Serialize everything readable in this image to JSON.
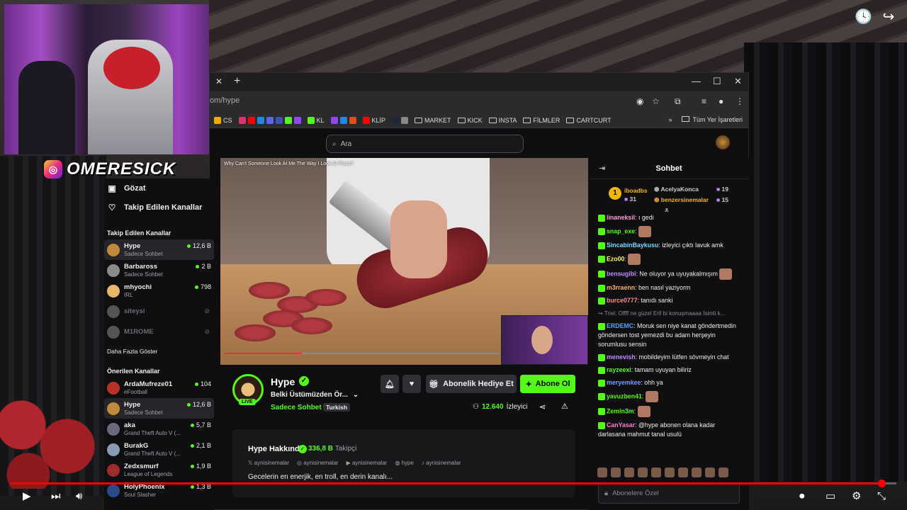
{
  "overlay": {
    "brand": "OMERESICK",
    "instagram_icon": "instagram-icon"
  },
  "browser": {
    "url": "om/hype",
    "bookmarks": [
      "CS",
      "KL",
      "KLİP",
      "MARKET",
      "KICK",
      "INSTA",
      "FİLMLER",
      "CARTCURT"
    ],
    "all_bookmarks": "Tüm Yer İşaretleri",
    "more_bookmarks": "»"
  },
  "kick": {
    "search_placeholder": "Ara",
    "nav": [
      {
        "label": "Gözat",
        "icon": "browse-icon"
      },
      {
        "label": "Takip Edilen Kanallar",
        "icon": "heart-icon"
      }
    ],
    "followed_title": "Takip Edilen Kanallar",
    "followed": [
      {
        "name": "Hype",
        "sub": "Sadece Sohbet",
        "count": "12,6 B",
        "color": "#c08a3c"
      },
      {
        "name": "Barbaross",
        "sub": "Sadece Sohbet",
        "count": "2 B",
        "color": "#8a8a8a"
      },
      {
        "name": "mhyochi",
        "sub": "IRL",
        "count": "798",
        "color": "#e6b86a"
      },
      {
        "name": "siteysi",
        "sub": "",
        "count": "",
        "color": "#555"
      },
      {
        "name": "M1ROME",
        "sub": "",
        "count": "",
        "color": "#555"
      }
    ],
    "show_more": "Daha Fazla Göster",
    "recommended_title": "Önerilen Kanallar",
    "recommended": [
      {
        "name": "ArdaMufreze01",
        "sub": "eFootball",
        "count": "104",
        "color": "#b8322a"
      },
      {
        "name": "Hype",
        "sub": "Sadece Sohbet",
        "count": "12,6 B",
        "color": "#c08a3c"
      },
      {
        "name": "aka",
        "sub": "Grand Theft Auto V (...",
        "count": "5,7 B",
        "color": "#6a6a7a"
      },
      {
        "name": "BurakG",
        "sub": "Grand Theft Auto V (...",
        "count": "2,1 B",
        "color": "#8a9ab0"
      },
      {
        "name": "Zedxsmurf",
        "sub": "League of Legends",
        "count": "1,9 B",
        "color": "#a02a2a"
      },
      {
        "name": "HolyPhoenix",
        "sub": "Soul Slasher",
        "count": "1,3 B",
        "color": "#2a4a8a"
      }
    ],
    "video_title": "Why Can't Someone Look At Me The Way I Look At Pizza?",
    "channel": {
      "name": "Hype",
      "live": "LIVE",
      "stream_title": "Belki Üstümüzden Ör...",
      "category": "Sadece Sohbet",
      "tag": "Turkish",
      "gift_label": "Abonelik Hediye Et",
      "sub_label": "Abone Ol",
      "viewers": "12.640",
      "viewers_label": "İzleyici"
    },
    "about": {
      "title": "Hype Hakkında",
      "followers": "336,8 B",
      "followers_label": "Takipçi",
      "socials": [
        "aynisinemalar",
        "aynisinemalar",
        "aynisinemalar",
        "hype",
        "aynisinemalar"
      ],
      "description": "Gecelerin en enerjik, en troll, en derin kanalı..."
    },
    "chat": {
      "title": "Sohbet",
      "gifters": [
        {
          "name": "iboadbs",
          "count": "31",
          "rank": "1"
        },
        {
          "name": "AcelyaKonca",
          "count": "19"
        },
        {
          "name": "benzersinemalar",
          "count": "15"
        }
      ],
      "messages": [
        {
          "user": "linaneksil",
          "text": ": ı gedi",
          "color": "#ff9ad0"
        },
        {
          "user": "snap_exe",
          "text": ":",
          "color": "#53fc18",
          "emote": true
        },
        {
          "user": "SincabinBaykusu",
          "text": ": izleyici çıktı lavuk amk",
          "color": "#7ad6ff"
        },
        {
          "user": "Ezo00",
          "text": ":",
          "color": "#fff36a",
          "emote": true
        },
        {
          "user": "bensugibi",
          "text": ": Ne oluyor ya uyuyakalmışım",
          "color": "#c08aff",
          "emote": true
        },
        {
          "user": "m3rraenn",
          "text": ": ben nasıl yaziyorm",
          "color": "#ffb070"
        },
        {
          "user": "burce0777",
          "text": ": tanıdı sanki",
          "color": "#ff8a8a"
        },
        {
          "user": "",
          "text": "↪ Triel: Offff ne güzel Erll bi konuşmaaaa İsimli k...",
          "color": "#8a8a90",
          "sys": true
        },
        {
          "user": "ERDEMC",
          "text": ": Moruk sen niye kanat göndertmedin göndersen tost yemezdi bu adam herşeyin sorumlusu sensin",
          "color": "#4aa3ff"
        },
        {
          "user": "menevish",
          "text": ": mobildeyim lütfen sövmeyin chat",
          "color": "#c08aff"
        },
        {
          "user": "rayzeexi",
          "text": ": tamam uyuyan biliriz",
          "color": "#53fc18"
        },
        {
          "user": "meryemkee",
          "text": ": ohh ya",
          "color": "#7a9aff"
        },
        {
          "user": "yavuzben41",
          "text": ":",
          "color": "#53fc18",
          "emote": true
        },
        {
          "user": "Zemin3m",
          "text": ":",
          "color": "#53fc18",
          "emote": true
        },
        {
          "user": "CanYasar",
          "text": ": @hype abonen olana kadar darlasana mahmut tanal usulü",
          "color": "#ff7ad0"
        }
      ],
      "input_placeholder": "Abonelere Özel"
    }
  },
  "colors": {
    "accent": "#53fc18",
    "bg": "#0f0f11",
    "yt_red": "#ff0000"
  },
  "player": {
    "progress": 0.984
  }
}
